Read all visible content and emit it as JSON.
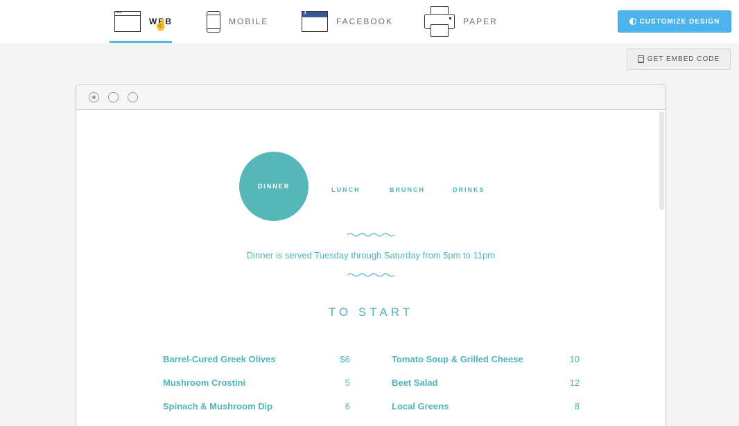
{
  "tabs": [
    {
      "label": "WEB",
      "icon": "browser-window-icon"
    },
    {
      "label": "MOBILE",
      "icon": "mobile-phone-icon"
    },
    {
      "label": "FACEBOOK",
      "icon": "facebook-window-icon"
    },
    {
      "label": "PAPER",
      "icon": "printer-icon"
    }
  ],
  "active_tab": "WEB",
  "buttons": {
    "customize": "CUSTOMIZE DESIGN",
    "embed": "GET EMBED CODE"
  },
  "colors": {
    "accent": "#4cb3ec",
    "menu_teal": "#56b6b9"
  },
  "menu": {
    "nav": [
      "DINNER",
      "LUNCH",
      "BRUNCH",
      "DRINKS"
    ],
    "selected": "DINNER",
    "served_text": "Dinner is served Tuesday through Saturday from 5pm to 11pm",
    "section_title": "TO START",
    "items_left": [
      {
        "name": "Barrel-Cured Greek Olives",
        "price": "$6"
      },
      {
        "name": "Mushroom Crostini",
        "price": "5"
      },
      {
        "name": "Spinach & Mushroom Dip",
        "price": "6"
      }
    ],
    "items_right": [
      {
        "name": "Tomato Soup & Grilled Cheese",
        "price": "10"
      },
      {
        "name": "Beet Salad",
        "price": "12"
      },
      {
        "name": "Local Greens",
        "price": "8"
      }
    ]
  }
}
